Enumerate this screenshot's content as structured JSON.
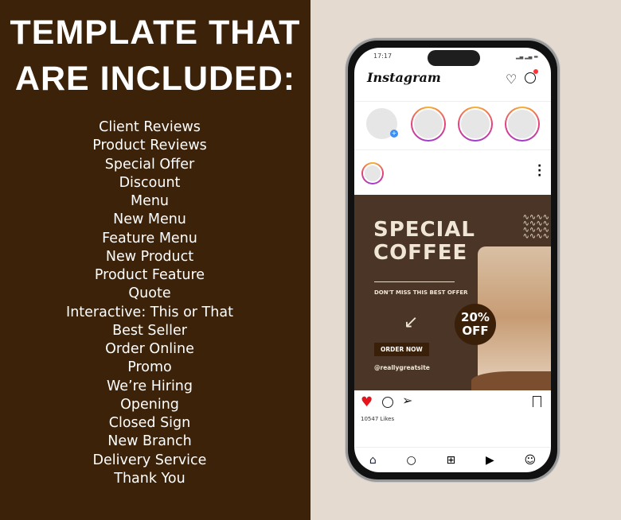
{
  "heading": {
    "line1": "TEMPLATE THAT",
    "line2": "ARE INCLUDED:"
  },
  "templates": [
    "Client Reviews",
    "Product Reviews",
    "Special Offer",
    "Discount",
    "Menu",
    "New Menu",
    "Feature Menu",
    "New Product",
    "Product Feature",
    "Quote",
    "Interactive: This or That",
    "Best Seller",
    "Order Online",
    "Promo",
    "We’re Hiring",
    "Opening",
    "Closed Sign",
    "New Branch",
    "Delivery Service",
    "Thank You"
  ],
  "phone": {
    "time": "17:17",
    "app_name": "Instagram",
    "post": {
      "title1": "SPECIAL",
      "title2": "COFFEE",
      "tagline": "DON'T MISS THIS BEST OFFER",
      "discount1": "20%",
      "discount2": "OFF",
      "cta": "ORDER NOW",
      "handle": "@reallygreatsite"
    },
    "likes": "10547 Likes"
  },
  "colors": {
    "left_bg": "#3c2209",
    "right_bg": "#e4dad0",
    "post_bg": "#4a3527",
    "like": "#e8141b"
  }
}
